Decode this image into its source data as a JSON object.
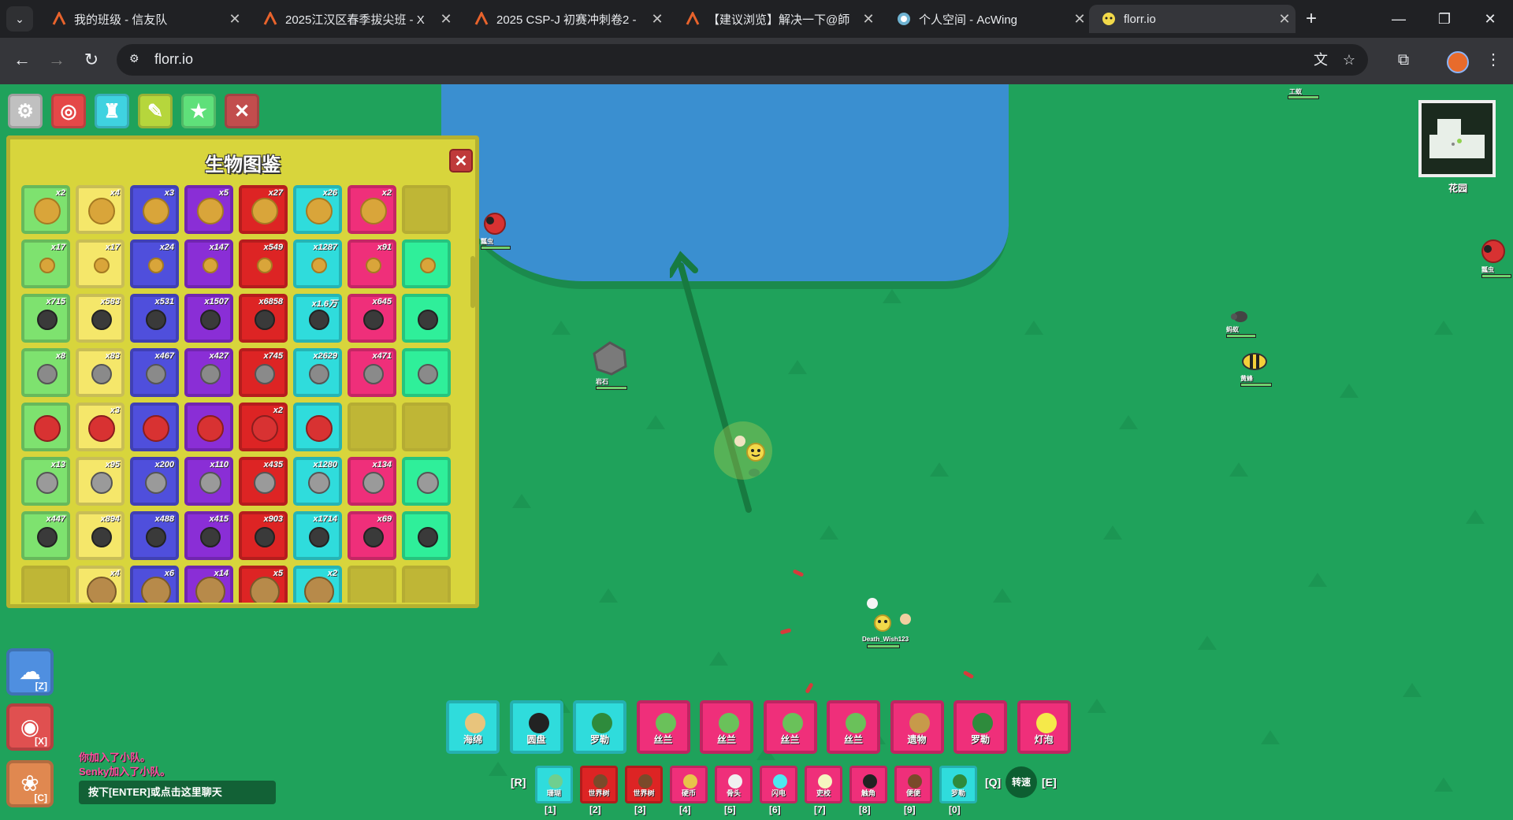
{
  "browser": {
    "tabs": [
      {
        "title": "我的班级 - 信友队",
        "icon": "xinyou-logo-icon",
        "active": false
      },
      {
        "title": "2025江汉区春季拔尖班 - X",
        "icon": "xinyou-logo-icon",
        "active": false
      },
      {
        "title": "2025 CSP-J 初赛冲刺卷2 -",
        "icon": "xinyou-logo-icon",
        "active": false
      },
      {
        "title": "【建议浏览】解决一下@師",
        "icon": "xinyou-logo-icon",
        "active": false
      },
      {
        "title": "个人空间 - AcWing",
        "icon": "acwing-logo-icon",
        "active": false
      },
      {
        "title": "florr.io",
        "icon": "florr-logo-icon",
        "active": true
      }
    ],
    "url": "florr.io"
  },
  "game": {
    "top_buttons": [
      {
        "name": "settings-button",
        "color": "#c0c0c0",
        "icon": "gear-icon"
      },
      {
        "name": "petal-gallery-button",
        "color": "#e44848",
        "icon": "target-icon"
      },
      {
        "name": "inventory-button",
        "color": "#3fd2e0",
        "icon": "tower-icon"
      },
      {
        "name": "craft-button",
        "color": "#b6d63c",
        "icon": "craft-icon"
      },
      {
        "name": "mobs-button",
        "color": "#5fe07a",
        "icon": "star-icon"
      },
      {
        "name": "close-all-button",
        "color": "#c24d4d",
        "icon": "close-icon"
      }
    ],
    "mob_gallery": {
      "title": "生物图鉴",
      "rarity_colors": [
        "#7ee26f",
        "#f5e76a",
        "#4f4fdc",
        "#8a2ed6",
        "#dd2424",
        "#2fdcdc",
        "#ef2f7a",
        "#2fef9a"
      ],
      "rows": [
        {
          "mob": "gold-ball",
          "counts": [
            "x2",
            "x4",
            "x3",
            "x5",
            "x27",
            "x26",
            "x2",
            ""
          ],
          "empty_last": true
        },
        {
          "mob": "small-gold",
          "counts": [
            "x17",
            "x17",
            "x24",
            "x147",
            "x549",
            "x1287",
            "x91",
            ""
          ],
          "empty_last": false
        },
        {
          "mob": "black-ant",
          "counts": [
            "x715",
            "x583",
            "x531",
            "x1507",
            "x6858",
            "x1.6万",
            "x645",
            ""
          ],
          "empty_last": false
        },
        {
          "mob": "gray-rock",
          "counts": [
            "x8",
            "x83",
            "x467",
            "x427",
            "x745",
            "x2629",
            "x471",
            ""
          ],
          "empty_last": false
        },
        {
          "mob": "ladybug-card",
          "counts": [
            "",
            "x3",
            "",
            "",
            "x2",
            "",
            "",
            ""
          ],
          "empty_tail": 2
        },
        {
          "mob": "gray-bee",
          "counts": [
            "x13",
            "x95",
            "x200",
            "x110",
            "x435",
            "x1280",
            "x134",
            ""
          ],
          "empty_last": false
        },
        {
          "mob": "black-beetle",
          "counts": [
            "x447",
            "x894",
            "x488",
            "x415",
            "x903",
            "x1714",
            "x69",
            ""
          ],
          "empty_last": false
        },
        {
          "mob": "shell",
          "counts": [
            "",
            "x4",
            "x6",
            "x14",
            "x5",
            "x2",
            "",
            ""
          ],
          "empty_first": true
        }
      ]
    },
    "minimap_label": "花园",
    "entities": [
      {
        "type": "ladybug",
        "label": "瓢虫"
      },
      {
        "type": "rock",
        "label": "岩石"
      },
      {
        "type": "ant",
        "label": "蚂蚁"
      },
      {
        "type": "bee",
        "label": "黄蜂"
      },
      {
        "type": "ladybug",
        "label": "瓢虫"
      },
      {
        "type": "worker",
        "label": "工蚁"
      },
      {
        "type": "player",
        "label": "Death_Wish123"
      }
    ],
    "side_buttons": [
      {
        "name": "ability-z-button",
        "key": "[Z]",
        "color": "#4f8fe0"
      },
      {
        "name": "ability-x-button",
        "key": "[X]",
        "color": "#e05050"
      },
      {
        "name": "ability-c-button",
        "key": "[C]",
        "color": "#e08850"
      }
    ],
    "chat": {
      "messages": [
        "你加入了小队。",
        "Senky加入了小队。"
      ],
      "input_placeholder": "按下[ENTER]或点击这里聊天"
    },
    "loadout_main": [
      {
        "label": "海绵",
        "color": "#2fdcdc",
        "icon_color": "#e8c47c"
      },
      {
        "label": "圆盘",
        "color": "#2fdcdc",
        "icon_color": "#222222"
      },
      {
        "label": "罗勒",
        "color": "#2fdcdc",
        "icon_color": "#2e8b3c"
      },
      {
        "label": "丝兰",
        "color": "#ef2f7a",
        "icon_color": "#6ac15a"
      },
      {
        "label": "丝兰",
        "color": "#ef2f7a",
        "icon_color": "#6ac15a"
      },
      {
        "label": "丝兰",
        "color": "#ef2f7a",
        "icon_color": "#6ac15a"
      },
      {
        "label": "丝兰",
        "color": "#ef2f7a",
        "icon_color": "#6ac15a"
      },
      {
        "label": "遗物",
        "color": "#ef2f7a",
        "icon_color": "#c79a4a"
      },
      {
        "label": "罗勒",
        "color": "#ef2f7a",
        "icon_color": "#2e8b3c"
      },
      {
        "label": "灯泡",
        "color": "#ef2f7a",
        "icon_color": "#f5e94a"
      }
    ],
    "loadout_secondary": [
      {
        "label": "珊瑚",
        "key": "[1]",
        "color": "#2fdcdc",
        "icon_color": "#6fcf8f"
      },
      {
        "label": "世界树",
        "key": "[2]",
        "color": "#dd2424",
        "icon_color": "#7a4a2a"
      },
      {
        "label": "世界树",
        "key": "[3]",
        "color": "#dd2424",
        "icon_color": "#7a4a2a"
      },
      {
        "label": "硬币",
        "key": "[4]",
        "color": "#ef2f7a",
        "icon_color": "#e8c44a"
      },
      {
        "label": "骨头",
        "key": "[5]",
        "color": "#ef2f7a",
        "icon_color": "#f0f0f0"
      },
      {
        "label": "闪电",
        "key": "[6]",
        "color": "#ef2f7a",
        "icon_color": "#4ee8f0"
      },
      {
        "label": "吏校",
        "key": "[7]",
        "color": "#ef2f7a",
        "icon_color": "#f5f5c0"
      },
      {
        "label": "触角",
        "key": "[8]",
        "color": "#ef2f7a",
        "icon_color": "#222222"
      },
      {
        "label": "便便",
        "key": "[9]",
        "color": "#ef2f7a",
        "icon_color": "#7a4a2a"
      },
      {
        "label": "罗勒",
        "key": "[0]",
        "color": "#2fdcdc",
        "icon_color": "#2e8b3c"
      }
    ],
    "hints": {
      "r": "[R]",
      "q": "[Q]",
      "e": "[E]",
      "speed": "转速"
    }
  }
}
